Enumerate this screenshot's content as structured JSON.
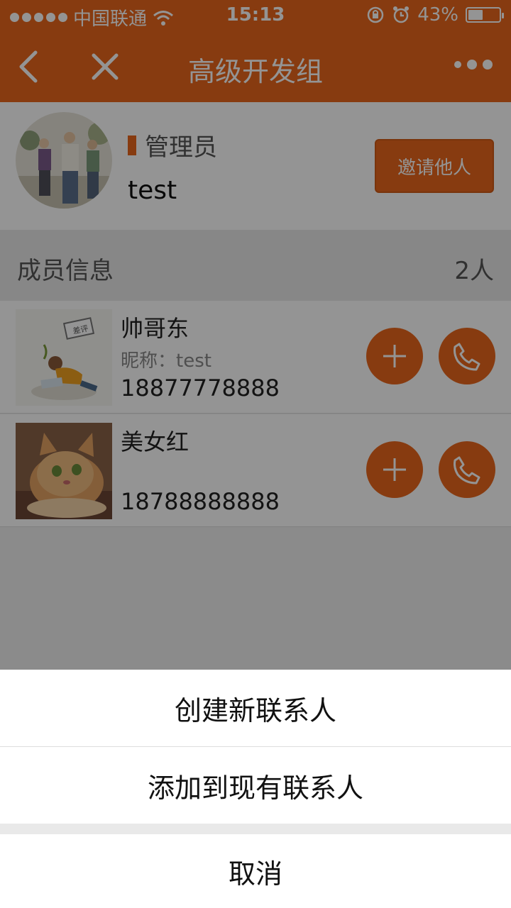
{
  "status": {
    "carrier": "中国联通",
    "time": "15:13",
    "battery": "43%"
  },
  "nav": {
    "title": "高级开发组"
  },
  "admin": {
    "role": "管理员",
    "name": "test",
    "invite_label": "邀请他人"
  },
  "members_header": {
    "label": "成员信息",
    "count": "2人"
  },
  "members": [
    {
      "name": "帅哥东",
      "nickname": "昵称：test",
      "phone": "18877778888"
    },
    {
      "name": "美女红",
      "nickname": "",
      "phone": "18788888888"
    }
  ],
  "action_sheet": {
    "options": [
      "创建新联系人",
      "添加到现有联系人"
    ],
    "cancel": "取消"
  },
  "colors": {
    "accent": "#e9671c"
  },
  "icons": [
    "wifi-icon",
    "lock-rotation-icon",
    "alarm-icon",
    "battery-icon",
    "back-chevron-icon",
    "close-icon",
    "more-icon",
    "plus-icon",
    "phone-icon"
  ]
}
